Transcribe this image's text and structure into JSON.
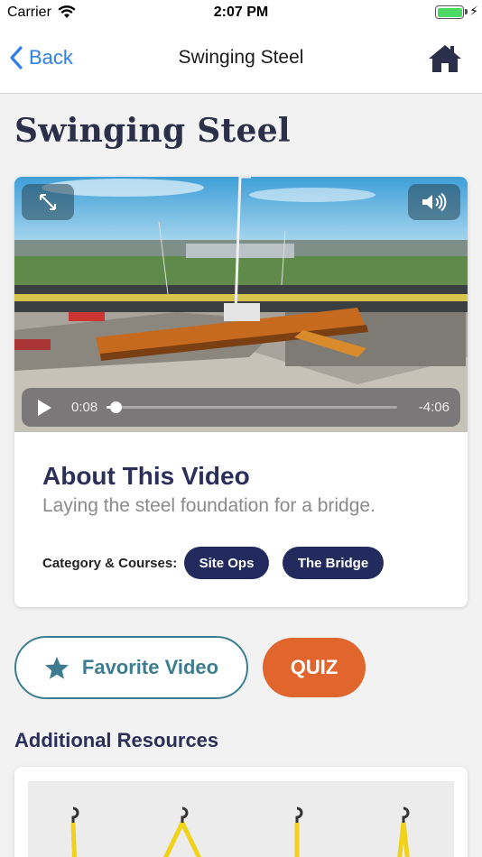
{
  "status_bar": {
    "carrier": "Carrier",
    "time": "2:07 PM"
  },
  "nav": {
    "back_label": "Back",
    "title": "Swinging Steel",
    "home_icon": "home-icon",
    "accent_color": "#2f7fe5"
  },
  "page": {
    "title": "Swinging Steel"
  },
  "video": {
    "elapsed": "0:08",
    "remaining": "-4:06",
    "progress_fraction": 0.032,
    "icons": [
      "expand-icon",
      "volume-icon",
      "play-icon"
    ]
  },
  "about": {
    "title": "About This Video",
    "description": "Laying the steel foundation for a bridge.",
    "category_label": "Category & Courses:",
    "chips": [
      "Site Ops",
      "The Bridge"
    ],
    "chip_color": "#222a5e"
  },
  "actions": {
    "favorite_label": "Favorite Video",
    "favorite_icon": "star-icon",
    "favorite_color": "#3d7d8f",
    "quiz_label": "QUIZ",
    "quiz_color": "#e0662e"
  },
  "resources": {
    "title": "Additional Resources"
  }
}
